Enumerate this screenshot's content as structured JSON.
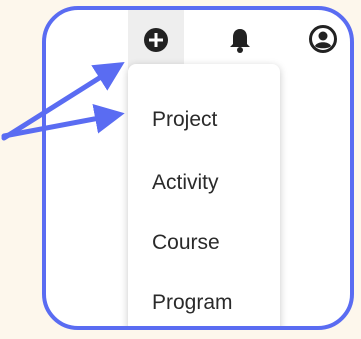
{
  "header": {
    "icons": [
      "plus-circle-icon",
      "bell-icon",
      "account-circle-icon"
    ]
  },
  "menu": {
    "items": [
      {
        "label": "Project"
      },
      {
        "label": "Activity"
      },
      {
        "label": "Course"
      },
      {
        "label": "Program"
      }
    ]
  },
  "colors": {
    "background": "#fdf7ec",
    "frame_border": "#5a6cf2",
    "arrow": "#5a6cf2",
    "icon": "#222222",
    "menu_text": "#2a2a2a"
  }
}
